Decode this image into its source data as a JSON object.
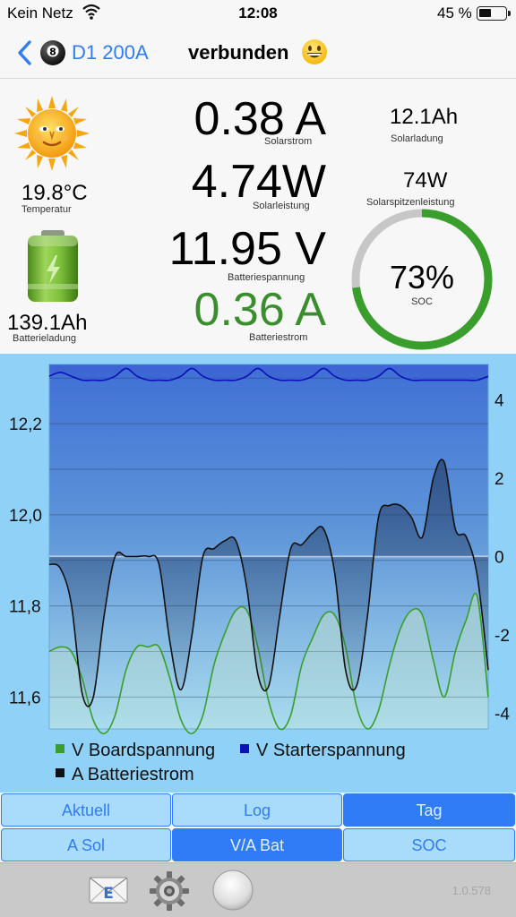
{
  "status_bar": {
    "carrier": "Kein Netz",
    "time": "12:08",
    "battery_percent": "45 %",
    "battery_level": 0.45
  },
  "nav": {
    "device_name": "D1 200A",
    "title": "verbunden",
    "icons": [
      "chevron-left-icon",
      "eight-ball-icon",
      "smiley-icon"
    ]
  },
  "metrics": {
    "solar_current": {
      "value": "0.38 A",
      "label": "Solarstrom"
    },
    "solar_power": {
      "value": "4.74W",
      "label": "Solarleistung"
    },
    "battery_voltage": {
      "value": "11.95 V",
      "label": "Batteriespannung"
    },
    "battery_current": {
      "value": "0.36 A",
      "label": "Batteriestrom"
    },
    "temperature": {
      "value": "19.8°C",
      "label": "Temperatur"
    },
    "battery_charge": {
      "value": "139.1Ah",
      "label": "Batterieladung"
    },
    "solar_charge": {
      "value": "12.1Ah",
      "label": "Solarladung"
    },
    "solar_peak": {
      "value": "74W",
      "label": "Solarspitzenleistung"
    },
    "soc": {
      "value": "73%",
      "label": "SOC",
      "fraction": 0.73
    }
  },
  "colors": {
    "accent": "#2f7cf6",
    "green": "#3a8e2d",
    "chart_bg": "#8fd1f7",
    "boardspannung": "#3a9e2d",
    "starterspannung": "#0b10b8",
    "batteriestrom": "#111111"
  },
  "chart_data": {
    "type": "line",
    "x": [
      0.0,
      0.5,
      1.0,
      1.5,
      2.0,
      2.5,
      3.0,
      3.5,
      4.0,
      4.5,
      5.0,
      5.5,
      6.0,
      6.5,
      7.0,
      7.5,
      8.0,
      8.5,
      9.0,
      9.5,
      10.0,
      10.5,
      11.0,
      11.5,
      12.0,
      12.5,
      13.0,
      13.5,
      14.0,
      14.5,
      15.0,
      15.5,
      16.0,
      16.5,
      17.0,
      17.5,
      18.0,
      18.5,
      19.0,
      19.5,
      20.0
    ],
    "left_axis": {
      "ticks": [
        "12,2",
        "12,0",
        "11,8",
        "11,6"
      ],
      "tick_values": [
        12.2,
        12.0,
        11.8,
        11.6
      ],
      "ylim": [
        11.53,
        12.33
      ]
    },
    "right_axis": {
      "ticks": [
        "4",
        "2",
        "0",
        "-2",
        "-4"
      ],
      "tick_values": [
        4,
        2,
        0,
        -2,
        -4
      ],
      "ylim": [
        -4.4,
        4.9
      ]
    },
    "series": [
      {
        "name": "V Boardspannung",
        "axis": "left",
        "color": "#3a9e2d",
        "values": [
          11.7,
          11.71,
          11.7,
          11.64,
          11.55,
          11.52,
          11.56,
          11.66,
          11.71,
          11.71,
          11.71,
          11.64,
          11.55,
          11.52,
          11.56,
          11.67,
          11.74,
          11.79,
          11.79,
          11.71,
          11.59,
          11.53,
          11.56,
          11.67,
          11.73,
          11.78,
          11.78,
          11.71,
          11.58,
          11.53,
          11.57,
          11.67,
          11.75,
          11.79,
          11.78,
          11.68,
          11.6,
          11.7,
          11.77,
          11.82,
          11.6
        ]
      },
      {
        "name": "V Starterspannung",
        "axis": "right",
        "color": "#0b10b8",
        "values": [
          4.6,
          4.7,
          4.6,
          4.5,
          4.5,
          4.5,
          4.6,
          4.8,
          4.6,
          4.5,
          4.5,
          4.5,
          4.6,
          4.8,
          4.6,
          4.5,
          4.5,
          4.5,
          4.6,
          4.8,
          4.6,
          4.5,
          4.5,
          4.5,
          4.6,
          4.8,
          4.6,
          4.5,
          4.5,
          4.5,
          4.6,
          4.8,
          4.6,
          4.5,
          4.5,
          4.5,
          4.5,
          4.5,
          4.5,
          4.5,
          4.6
        ]
      },
      {
        "name": "A Batteriestrom",
        "axis": "right",
        "color": "#111111",
        "values": [
          -0.2,
          -0.3,
          -1.2,
          -3.5,
          -3.6,
          -1.5,
          0.0,
          0.0,
          0.0,
          0.0,
          -0.2,
          -2.2,
          -3.4,
          -2.0,
          0.0,
          0.2,
          0.4,
          0.4,
          -0.8,
          -3.0,
          -3.3,
          -1.5,
          0.2,
          0.3,
          0.6,
          0.7,
          -0.4,
          -2.9,
          -3.3,
          -1.5,
          1.0,
          1.3,
          1.3,
          1.0,
          0.5,
          2.0,
          2.4,
          0.7,
          0.5,
          -0.5,
          -2.9
        ]
      }
    ]
  },
  "buttons": [
    {
      "label": "Aktuell",
      "active": false
    },
    {
      "label": "Log",
      "active": false
    },
    {
      "label": "Tag",
      "active": true
    },
    {
      "label": "A Sol",
      "active": false
    },
    {
      "label": "V/A Bat",
      "active": true
    },
    {
      "label": "SOC",
      "active": false
    }
  ],
  "toolbar": {
    "icons": [
      "mail-icon",
      "settings-gear-icon",
      "record-button-icon"
    ],
    "version": "1.0.578"
  }
}
